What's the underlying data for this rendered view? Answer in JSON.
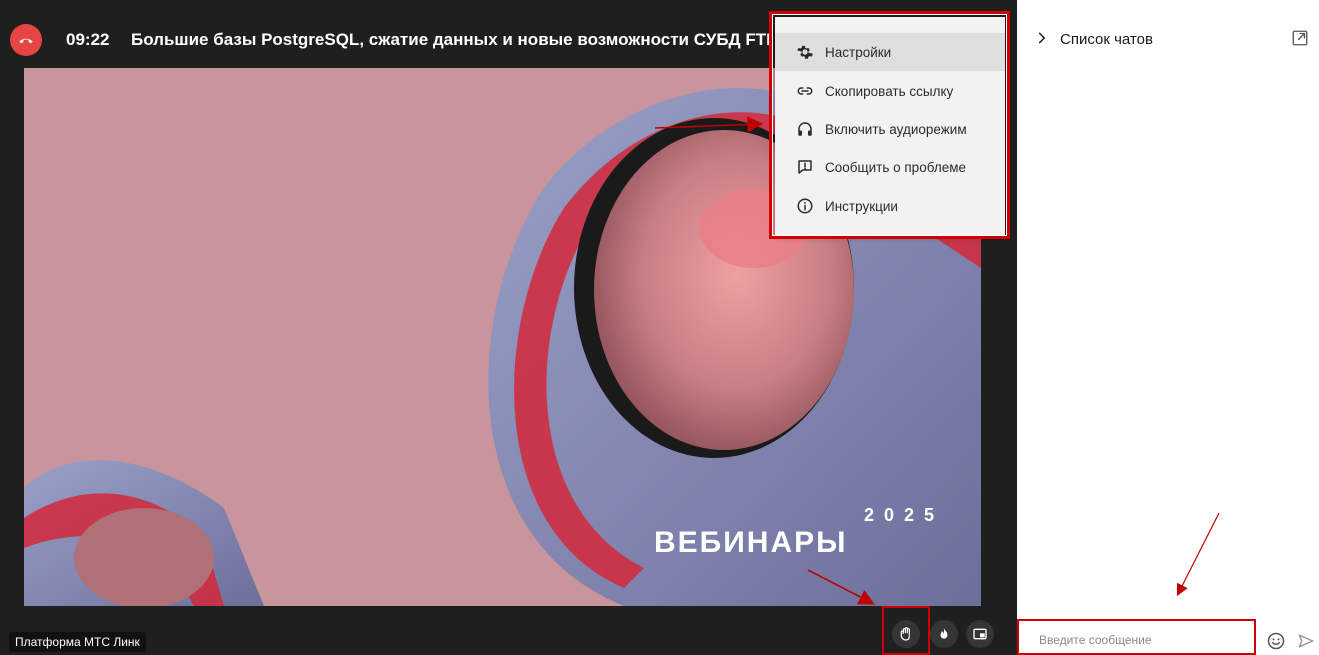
{
  "header": {
    "time": "09:22",
    "title": "Большие базы PostgreSQL, сжатие данных и новые возможности СУБД FTD"
  },
  "menu": {
    "items": [
      {
        "label": "Настройки",
        "icon": "gear-icon",
        "active": true
      },
      {
        "label": "Скопировать ссылку",
        "icon": "link-icon"
      },
      {
        "label": "Включить аудиорежим",
        "icon": "headphones-icon"
      },
      {
        "label": "Сообщить о проблеме",
        "icon": "report-icon"
      },
      {
        "label": "Инструкции",
        "icon": "info-icon"
      }
    ]
  },
  "stage": {
    "banner_year": "2025",
    "banner_text": "ВЕБИНАРЫ"
  },
  "footer": {
    "platform": "Платформа МТС Линк"
  },
  "chat": {
    "title": "Список чатов",
    "input_placeholder": "Введите сообщение"
  },
  "colors": {
    "accent_red": "#e64545",
    "highlight_red": "#d10000",
    "stage_bg": "#c7959b",
    "dark_bg": "#1f1f1f"
  }
}
